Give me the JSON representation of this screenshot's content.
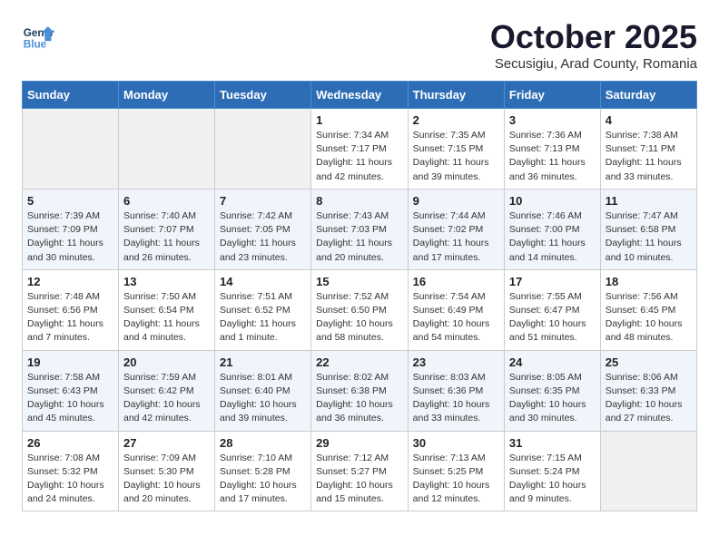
{
  "logo": {
    "line1": "General",
    "line2": "Blue"
  },
  "title": "October 2025",
  "subtitle": "Secusigiu, Arad County, Romania",
  "days_of_week": [
    "Sunday",
    "Monday",
    "Tuesday",
    "Wednesday",
    "Thursday",
    "Friday",
    "Saturday"
  ],
  "weeks": [
    [
      {
        "day": "",
        "info": ""
      },
      {
        "day": "",
        "info": ""
      },
      {
        "day": "",
        "info": ""
      },
      {
        "day": "1",
        "info": "Sunrise: 7:34 AM\nSunset: 7:17 PM\nDaylight: 11 hours\nand 42 minutes."
      },
      {
        "day": "2",
        "info": "Sunrise: 7:35 AM\nSunset: 7:15 PM\nDaylight: 11 hours\nand 39 minutes."
      },
      {
        "day": "3",
        "info": "Sunrise: 7:36 AM\nSunset: 7:13 PM\nDaylight: 11 hours\nand 36 minutes."
      },
      {
        "day": "4",
        "info": "Sunrise: 7:38 AM\nSunset: 7:11 PM\nDaylight: 11 hours\nand 33 minutes."
      }
    ],
    [
      {
        "day": "5",
        "info": "Sunrise: 7:39 AM\nSunset: 7:09 PM\nDaylight: 11 hours\nand 30 minutes."
      },
      {
        "day": "6",
        "info": "Sunrise: 7:40 AM\nSunset: 7:07 PM\nDaylight: 11 hours\nand 26 minutes."
      },
      {
        "day": "7",
        "info": "Sunrise: 7:42 AM\nSunset: 7:05 PM\nDaylight: 11 hours\nand 23 minutes."
      },
      {
        "day": "8",
        "info": "Sunrise: 7:43 AM\nSunset: 7:03 PM\nDaylight: 11 hours\nand 20 minutes."
      },
      {
        "day": "9",
        "info": "Sunrise: 7:44 AM\nSunset: 7:02 PM\nDaylight: 11 hours\nand 17 minutes."
      },
      {
        "day": "10",
        "info": "Sunrise: 7:46 AM\nSunset: 7:00 PM\nDaylight: 11 hours\nand 14 minutes."
      },
      {
        "day": "11",
        "info": "Sunrise: 7:47 AM\nSunset: 6:58 PM\nDaylight: 11 hours\nand 10 minutes."
      }
    ],
    [
      {
        "day": "12",
        "info": "Sunrise: 7:48 AM\nSunset: 6:56 PM\nDaylight: 11 hours\nand 7 minutes."
      },
      {
        "day": "13",
        "info": "Sunrise: 7:50 AM\nSunset: 6:54 PM\nDaylight: 11 hours\nand 4 minutes."
      },
      {
        "day": "14",
        "info": "Sunrise: 7:51 AM\nSunset: 6:52 PM\nDaylight: 11 hours\nand 1 minute."
      },
      {
        "day": "15",
        "info": "Sunrise: 7:52 AM\nSunset: 6:50 PM\nDaylight: 10 hours\nand 58 minutes."
      },
      {
        "day": "16",
        "info": "Sunrise: 7:54 AM\nSunset: 6:49 PM\nDaylight: 10 hours\nand 54 minutes."
      },
      {
        "day": "17",
        "info": "Sunrise: 7:55 AM\nSunset: 6:47 PM\nDaylight: 10 hours\nand 51 minutes."
      },
      {
        "day": "18",
        "info": "Sunrise: 7:56 AM\nSunset: 6:45 PM\nDaylight: 10 hours\nand 48 minutes."
      }
    ],
    [
      {
        "day": "19",
        "info": "Sunrise: 7:58 AM\nSunset: 6:43 PM\nDaylight: 10 hours\nand 45 minutes."
      },
      {
        "day": "20",
        "info": "Sunrise: 7:59 AM\nSunset: 6:42 PM\nDaylight: 10 hours\nand 42 minutes."
      },
      {
        "day": "21",
        "info": "Sunrise: 8:01 AM\nSunset: 6:40 PM\nDaylight: 10 hours\nand 39 minutes."
      },
      {
        "day": "22",
        "info": "Sunrise: 8:02 AM\nSunset: 6:38 PM\nDaylight: 10 hours\nand 36 minutes."
      },
      {
        "day": "23",
        "info": "Sunrise: 8:03 AM\nSunset: 6:36 PM\nDaylight: 10 hours\nand 33 minutes."
      },
      {
        "day": "24",
        "info": "Sunrise: 8:05 AM\nSunset: 6:35 PM\nDaylight: 10 hours\nand 30 minutes."
      },
      {
        "day": "25",
        "info": "Sunrise: 8:06 AM\nSunset: 6:33 PM\nDaylight: 10 hours\nand 27 minutes."
      }
    ],
    [
      {
        "day": "26",
        "info": "Sunrise: 7:08 AM\nSunset: 5:32 PM\nDaylight: 10 hours\nand 24 minutes."
      },
      {
        "day": "27",
        "info": "Sunrise: 7:09 AM\nSunset: 5:30 PM\nDaylight: 10 hours\nand 20 minutes."
      },
      {
        "day": "28",
        "info": "Sunrise: 7:10 AM\nSunset: 5:28 PM\nDaylight: 10 hours\nand 17 minutes."
      },
      {
        "day": "29",
        "info": "Sunrise: 7:12 AM\nSunset: 5:27 PM\nDaylight: 10 hours\nand 15 minutes."
      },
      {
        "day": "30",
        "info": "Sunrise: 7:13 AM\nSunset: 5:25 PM\nDaylight: 10 hours\nand 12 minutes."
      },
      {
        "day": "31",
        "info": "Sunrise: 7:15 AM\nSunset: 5:24 PM\nDaylight: 10 hours\nand 9 minutes."
      },
      {
        "day": "",
        "info": ""
      }
    ]
  ]
}
